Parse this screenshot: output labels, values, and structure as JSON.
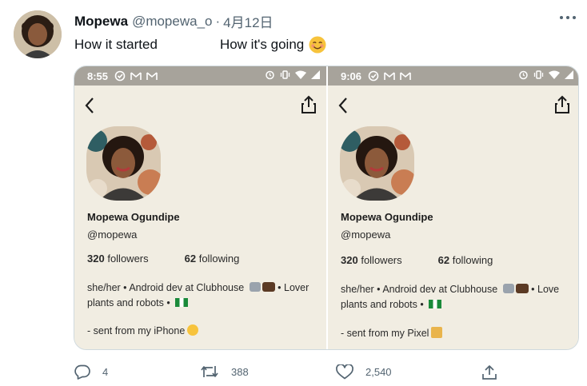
{
  "author": {
    "name": "Mopewa",
    "handle": "@mopewa_o",
    "separator": "·",
    "date": "4月12日"
  },
  "tweet": {
    "text_part1": "How it started",
    "text_part2": "How it's going",
    "emoji": "smiling-face-icon"
  },
  "phones": [
    {
      "time": "8:55",
      "name": "Mopewa Ogundipe",
      "username": "@mopewa",
      "followers_count": "320",
      "followers_label": "followers",
      "following_count": "62",
      "following_label": "following",
      "bio_line1": "she/her • Android dev at Clubhouse",
      "bio_line1_tail": "• Lover",
      "bio_line2": "plants and robots •",
      "sent_from": "- sent from my iPhone"
    },
    {
      "time": "9:06",
      "name": "Mopewa Ogundipe",
      "username": "@mopewa",
      "followers_count": "320",
      "followers_label": "followers",
      "following_count": "62",
      "following_label": "following",
      "bio_line1": "she/her • Android dev at Clubhouse",
      "bio_line1_tail": "• Love",
      "bio_line2": "plants and robots •",
      "sent_from": "- sent from my Pixel"
    }
  ],
  "actions": {
    "replies": "4",
    "retweets": "388",
    "likes": "2,540"
  },
  "colors": {
    "accent_green": "#17bf63",
    "secondary_text": "#536471",
    "statusbar": "#a7a39b",
    "phone_bg": "#f1ede2"
  }
}
